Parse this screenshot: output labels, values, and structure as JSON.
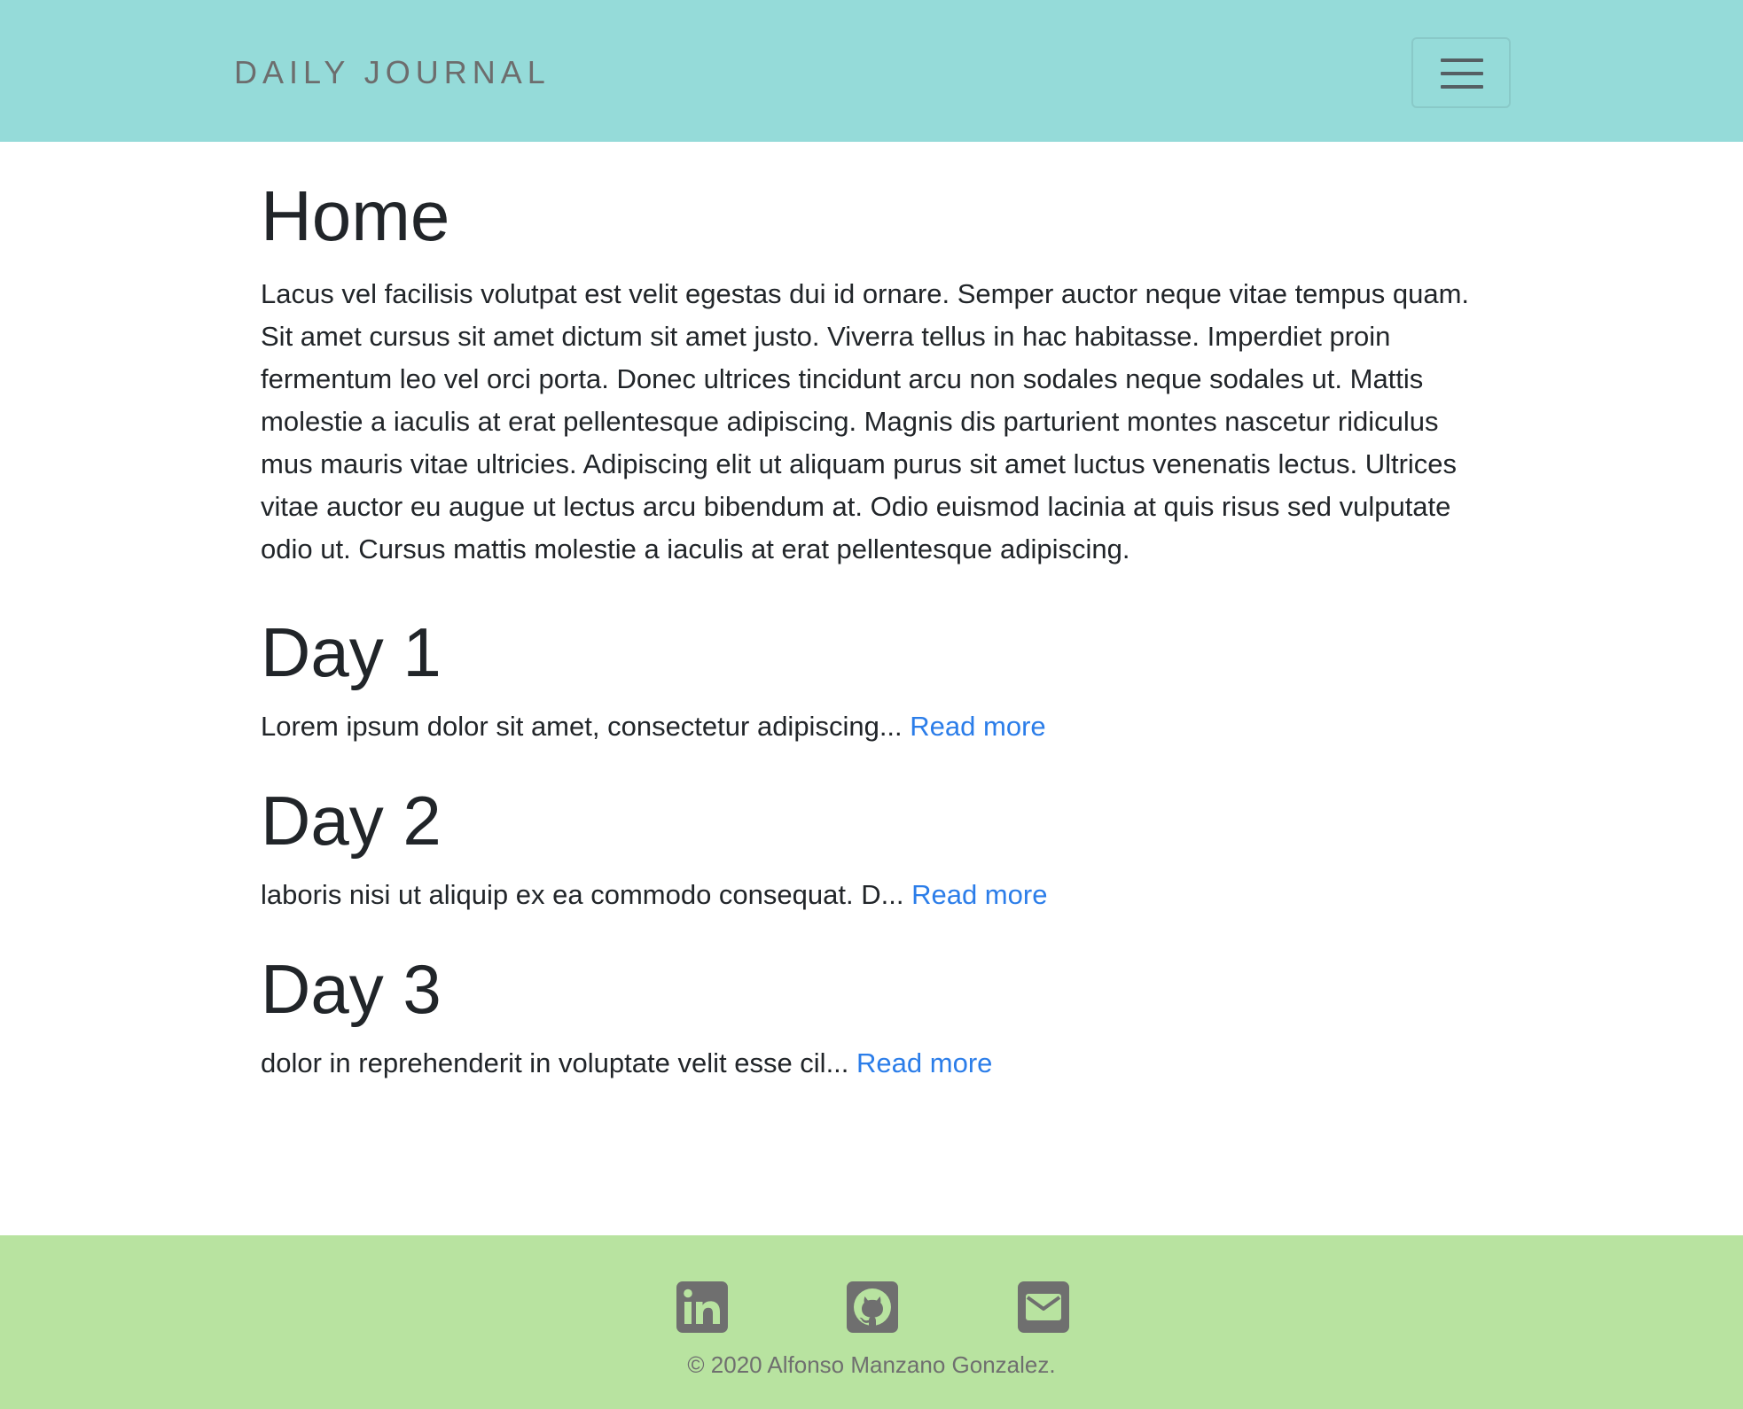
{
  "navbar": {
    "brand": "DAILY JOURNAL",
    "toggler_icon": "hamburger-menu-icon",
    "background": "#95dbd9"
  },
  "main": {
    "title": "Home",
    "intro": "Lacus vel facilisis volutpat est velit egestas dui id ornare. Semper auctor neque vitae tempus quam. Sit amet cursus sit amet dictum sit amet justo. Viverra tellus in hac habitasse. Imperdiet proin fermentum leo vel orci porta. Donec ultrices tincidunt arcu non sodales neque sodales ut. Mattis molestie a iaculis at erat pellentesque adipiscing. Magnis dis parturient montes nascetur ridiculus mus mauris vitae ultricies. Adipiscing elit ut aliquam purus sit amet luctus venenatis lectus. Ultrices vitae auctor eu augue ut lectus arcu bibendum at. Odio euismod lacinia at quis risus sed vulputate odio ut. Cursus mattis molestie a iaculis at erat pellentesque adipiscing.",
    "posts": [
      {
        "title": "Day 1",
        "excerpt": "Lorem ipsum dolor sit amet, consectetur adipiscing...",
        "link_label": "Read more"
      },
      {
        "title": "Day 2",
        "excerpt": "laboris nisi ut aliquip ex ea commodo consequat. D...",
        "link_label": "Read more"
      },
      {
        "title": "Day 3",
        "excerpt": "dolor in reprehenderit in voluptate velit esse cil...",
        "link_label": "Read more"
      }
    ],
    "link_color": "#2b7de9"
  },
  "footer": {
    "icons": [
      "linkedin-icon",
      "github-icon",
      "email-icon"
    ],
    "copyright": "© 2020 Alfonso Manzano Gonzalez.",
    "background": "#b8e3a0"
  }
}
